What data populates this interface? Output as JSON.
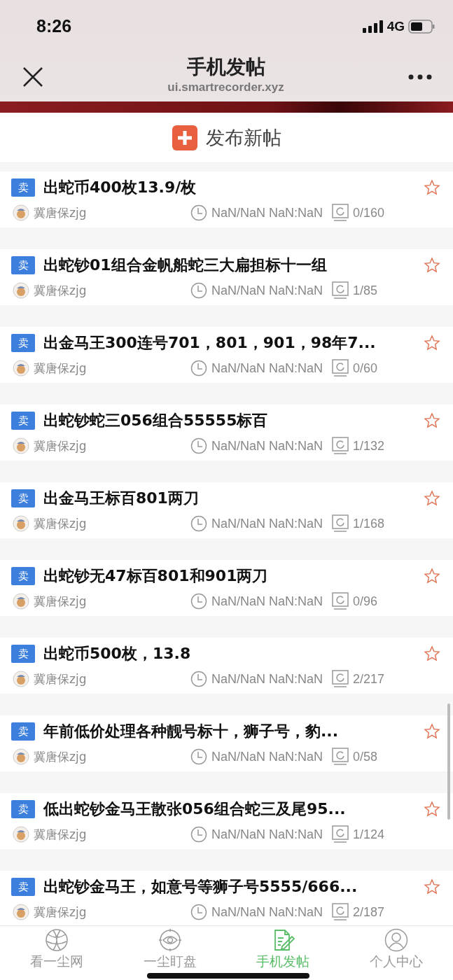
{
  "status_bar": {
    "time": "8:26",
    "network": "4G"
  },
  "nav": {
    "title": "手机发帖",
    "url": "ui.smartrecorder.xyz"
  },
  "new_post_button": {
    "label": "发布新帖"
  },
  "posts": [
    {
      "tag": "卖",
      "title": "出蛇币400枚13.9/枚",
      "author": "冀唐保zjg",
      "time": "NaN/NaN NaN:NaN",
      "count": "0/160",
      "starred": false
    },
    {
      "tag": "卖",
      "title": "出蛇钞01组合金帆船蛇三大扁担标十一组",
      "author": "冀唐保zjg",
      "time": "NaN/NaN NaN:NaN",
      "count": "1/85",
      "starred": false
    },
    {
      "tag": "卖",
      "title": "出金马王300连号701，801，901，98年7...",
      "author": "冀唐保zjg",
      "time": "NaN/NaN NaN:NaN",
      "count": "0/60",
      "starred": false
    },
    {
      "tag": "卖",
      "title": "出蛇钞蛇三056组合55555标百",
      "author": "冀唐保zjg",
      "time": "NaN/NaN NaN:NaN",
      "count": "1/132",
      "starred": false
    },
    {
      "tag": "卖",
      "title": "出金马王标百801两刀",
      "author": "冀唐保zjg",
      "time": "NaN/NaN NaN:NaN",
      "count": "1/168",
      "starred": false
    },
    {
      "tag": "卖",
      "title": "出蛇钞无47标百801和901两刀",
      "author": "冀唐保zjg",
      "time": "NaN/NaN NaN:NaN",
      "count": "0/96",
      "starred": false
    },
    {
      "tag": "卖",
      "title": "出蛇币500枚，13.8",
      "author": "冀唐保zjg",
      "time": "NaN/NaN NaN:NaN",
      "count": "2/217",
      "starred": false
    },
    {
      "tag": "卖",
      "title": "年前低价处理各种靓号标十，狮子号，豹...",
      "author": "冀唐保zjg",
      "time": "NaN/NaN NaN:NaN",
      "count": "0/58",
      "starred": false
    },
    {
      "tag": "卖",
      "title": "低出蛇钞金马王散张056组合蛇三及尾95...",
      "author": "冀唐保zjg",
      "time": "NaN/NaN NaN:NaN",
      "count": "1/124",
      "starred": false
    },
    {
      "tag": "卖",
      "title": "出蛇钞金马王，如意号等狮子号5555/666...",
      "author": "冀唐保zjg",
      "time": "NaN/NaN NaN:NaN",
      "count": "2/187",
      "starred": false
    }
  ],
  "tab_bar": [
    {
      "kind": "globe",
      "label": "看一尘网",
      "selected": false
    },
    {
      "kind": "eye",
      "label": "一尘盯盘",
      "selected": false
    },
    {
      "kind": "edit",
      "label": "手机发帖",
      "selected": true
    },
    {
      "kind": "person",
      "label": "个人中心",
      "selected": false
    }
  ]
}
